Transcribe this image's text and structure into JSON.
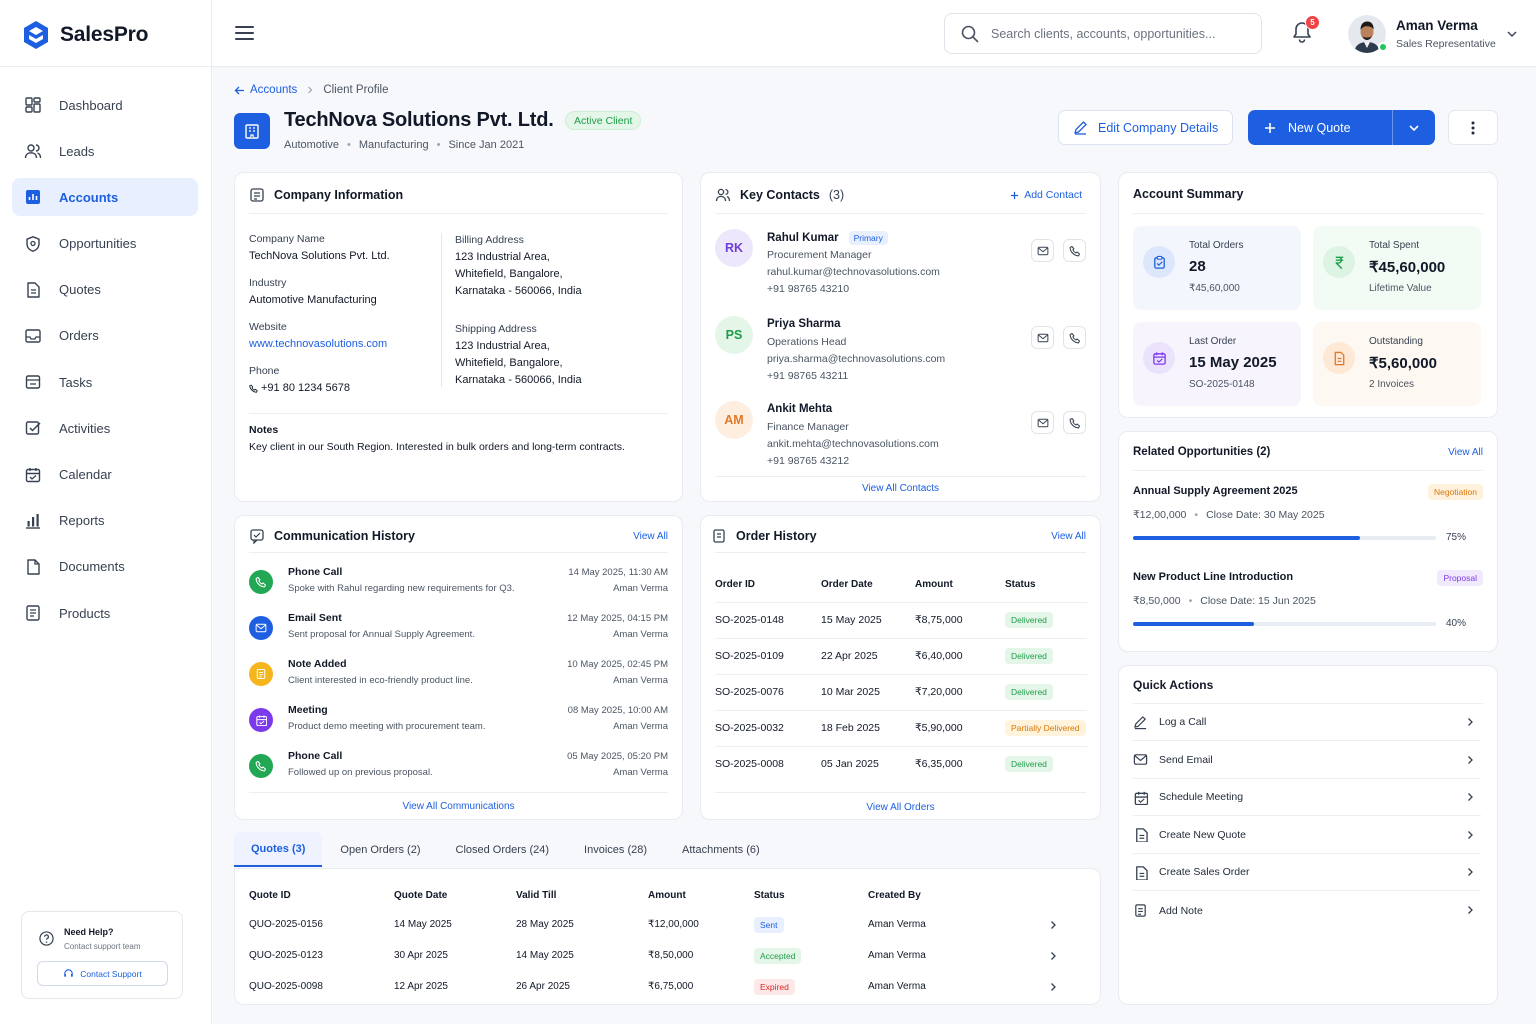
{
  "app": {
    "name": "SalesPro"
  },
  "sidebar": {
    "items": [
      {
        "label": "Dashboard",
        "icon": "dashboard-icon",
        "active": false
      },
      {
        "label": "Leads",
        "icon": "users-icon",
        "active": false
      },
      {
        "label": "Accounts",
        "icon": "building-icon",
        "active": true
      },
      {
        "label": "Opportunities",
        "icon": "shield-icon",
        "active": false
      },
      {
        "label": "Quotes",
        "icon": "document-icon",
        "active": false
      },
      {
        "label": "Orders",
        "icon": "mail-box-icon",
        "active": false
      },
      {
        "label": "Tasks",
        "icon": "tray-icon",
        "active": false
      },
      {
        "label": "Activities",
        "icon": "check-square-icon",
        "active": false
      },
      {
        "label": "Calendar",
        "icon": "calendar-icon",
        "active": false
      },
      {
        "label": "Reports",
        "icon": "bar-chart-icon",
        "active": false
      },
      {
        "label": "Documents",
        "icon": "file-icon",
        "active": false
      },
      {
        "label": "Products",
        "icon": "list-file-icon",
        "active": false
      }
    ],
    "help": {
      "title": "Need Help?",
      "subtitle": "Contact support team",
      "button": "Contact Support"
    }
  },
  "topbar": {
    "search_placeholder": "Search clients, accounts, opportunities...",
    "notifications": "5",
    "user": {
      "name": "Aman Verma",
      "role": "Sales Representative"
    }
  },
  "breadcrumb": {
    "parent": "Accounts",
    "current": "Client Profile"
  },
  "company": {
    "name": "TechNova Solutions Pvt. Ltd.",
    "status": "Active Client",
    "meta": [
      "Automotive",
      "Manufacturing",
      "Since Jan 2021"
    ]
  },
  "actions": {
    "edit": "Edit Company Details",
    "new_quote": "New Quote"
  },
  "company_info": {
    "title": "Company Information",
    "company_name_label": "Company Name",
    "company_name": "TechNova Solutions Pvt. Ltd.",
    "industry_label": "Industry",
    "industry": "Automotive Manufacturing",
    "website_label": "Website",
    "website": "www.technovasolutions.com",
    "phone_label": "Phone",
    "phone": "+91 80 1234 5678",
    "billing_label": "Billing Address",
    "billing": [
      "123 Industrial Area,",
      "Whitefield, Bangalore,",
      "Karnataka - 560066, India"
    ],
    "shipping_label": "Shipping Address",
    "shipping": [
      "123 Industrial Area,",
      "Whitefield, Bangalore,",
      "Karnataka - 560066, India"
    ],
    "notes_label": "Notes",
    "notes": "Key client in our South Region. Interested in bulk orders and long-term contracts."
  },
  "contacts": {
    "title": "Key Contacts",
    "count": "(3)",
    "add": "Add Contact",
    "view_all": "View All Contacts",
    "items": [
      {
        "initials": "RK",
        "name": "Rahul Kumar",
        "badge": "Primary",
        "role": "Procurement Manager",
        "email": "rahul.kumar@technovasolutions.com",
        "phone": "+91 98765 43210",
        "bg": "#ede7fb",
        "fg": "#6d3fd6"
      },
      {
        "initials": "PS",
        "name": "Priya Sharma",
        "badge": "",
        "role": "Operations Head",
        "email": "priya.sharma@technovasolutions.com",
        "phone": "+91 98765 43211",
        "bg": "#e4f6e8",
        "fg": "#1f9d4a"
      },
      {
        "initials": "AM",
        "name": "Ankit Mehta",
        "badge": "",
        "role": "Finance Manager",
        "email": "ankit.mehta@technovasolutions.com",
        "phone": "+91 98765 43212",
        "bg": "#fdeee0",
        "fg": "#e07a2a"
      }
    ]
  },
  "summary": {
    "title": "Account Summary",
    "stats": [
      {
        "title": "Total Orders",
        "value": "28",
        "sub": "₹45,60,000",
        "icon": "clipboard-icon",
        "bg": "#f3f6fd",
        "ic_bg": "#dde7fb",
        "ic_fg": "#1d5fe0"
      },
      {
        "title": "Total Spent",
        "value": "₹45,60,000",
        "sub": "Lifetime Value",
        "icon": "rupee-icon",
        "bg": "#f3fbf5",
        "ic_bg": "#ddf3e3",
        "ic_fg": "#1f9d4a"
      },
      {
        "title": "Last Order",
        "value": "15 May 2025",
        "sub": "SO-2025-0148",
        "icon": "calendar-check-icon",
        "bg": "#f7f4fd",
        "ic_bg": "#ebe3fb",
        "ic_fg": "#7c3aed"
      },
      {
        "title": "Outstanding",
        "value": "₹5,60,000",
        "sub": "2 Invoices",
        "icon": "invoice-icon",
        "bg": "#fdf8f2",
        "ic_bg": "#fde9d5",
        "ic_fg": "#e07a2a"
      }
    ]
  },
  "opportunities": {
    "title": "Related Opportunities (2)",
    "view_all": "View All",
    "items": [
      {
        "name": "Annual Supply Agreement 2025",
        "stage": "Negotiation",
        "amount": "₹12,00,000",
        "close": "Close Date: 30 May 2025",
        "progress": 75,
        "progress_label": "75%",
        "badge_bg": "#fff1dc",
        "badge_fg": "#d97706"
      },
      {
        "name": "New Product Line Introduction",
        "stage": "Proposal",
        "amount": "₹8,50,000",
        "close": "Close Date: 15 Jun 2025",
        "progress": 40,
        "progress_label": "40%",
        "badge_bg": "#f1e9fd",
        "badge_fg": "#7c3aed"
      }
    ]
  },
  "quick_actions": {
    "title": "Quick Actions",
    "items": [
      {
        "label": "Log a Call",
        "icon": "pencil-icon"
      },
      {
        "label": "Send Email",
        "icon": "mail-icon"
      },
      {
        "label": "Schedule Meeting",
        "icon": "calendar-icon"
      },
      {
        "label": "Create New Quote",
        "icon": "document-icon"
      },
      {
        "label": "Create Sales Order",
        "icon": "document-icon"
      },
      {
        "label": "Add Note",
        "icon": "note-icon"
      }
    ]
  },
  "communications": {
    "title": "Communication History",
    "view_all": "View All",
    "view_all_bottom": "View All Communications",
    "items": [
      {
        "type": "Phone Call",
        "desc": "Spoke with Rahul regarding new requirements for Q3.",
        "when": "14 May 2025, 11:30 AM",
        "user": "Aman Verma",
        "icon": "phone-icon",
        "color": "#22a855"
      },
      {
        "type": "Email Sent",
        "desc": "Sent proposal for Annual Supply Agreement.",
        "when": "12 May 2025, 04:15 PM",
        "user": "Aman Verma",
        "icon": "mail-icon",
        "color": "#1d5fe0"
      },
      {
        "type": "Note Added",
        "desc": "Client interested in eco-friendly product line.",
        "when": "10 May 2025, 02:45 PM",
        "user": "Aman Verma",
        "icon": "note-icon",
        "color": "#f5b51d"
      },
      {
        "type": "Meeting",
        "desc": "Product demo meeting with procurement team.",
        "when": "08 May 2025, 10:00 AM",
        "user": "Aman Verma",
        "icon": "calendar-icon",
        "color": "#7c3aed"
      },
      {
        "type": "Phone Call",
        "desc": "Followed up on previous proposal.",
        "when": "05 May 2025, 05:20 PM",
        "user": "Aman Verma",
        "icon": "phone-icon",
        "color": "#22a855"
      }
    ]
  },
  "orders": {
    "title": "Order History",
    "view_all": "View All",
    "view_all_bottom": "View All Orders",
    "columns": [
      "Order ID",
      "Order Date",
      "Amount",
      "Status"
    ],
    "rows": [
      {
        "id": "SO-2025-0148",
        "date": "15 May 2025",
        "amount": "₹8,75,000",
        "status": "Delivered",
        "kind": "delivered"
      },
      {
        "id": "SO-2025-0109",
        "date": "22 Apr 2025",
        "amount": "₹6,40,000",
        "status": "Delivered",
        "kind": "delivered"
      },
      {
        "id": "SO-2025-0076",
        "date": "10 Mar 2025",
        "amount": "₹7,20,000",
        "status": "Delivered",
        "kind": "delivered"
      },
      {
        "id": "SO-2025-0032",
        "date": "18 Feb 2025",
        "amount": "₹5,90,000",
        "status": "Partially Delivered",
        "kind": "partial"
      },
      {
        "id": "SO-2025-0008",
        "date": "05 Jan 2025",
        "amount": "₹6,35,000",
        "status": "Delivered",
        "kind": "delivered"
      }
    ]
  },
  "tabs": [
    {
      "label": "Quotes (3)",
      "active": true
    },
    {
      "label": "Open Orders (2)",
      "active": false
    },
    {
      "label": "Closed Orders (24)",
      "active": false
    },
    {
      "label": "Invoices (28)",
      "active": false
    },
    {
      "label": "Attachments (6)",
      "active": false
    }
  ],
  "quotes": {
    "columns": [
      "Quote ID",
      "Quote Date",
      "Valid Till",
      "Amount",
      "Status",
      "Created By"
    ],
    "rows": [
      {
        "id": "QUO-2025-0156",
        "date": "14 May 2025",
        "valid": "28 May 2025",
        "amount": "₹12,00,000",
        "status": "Sent",
        "kind": "sent",
        "by": "Aman Verma"
      },
      {
        "id": "QUO-2025-0123",
        "date": "30 Apr 2025",
        "valid": "14 May 2025",
        "amount": "₹8,50,000",
        "status": "Accepted",
        "kind": "accepted",
        "by": "Aman Verma"
      },
      {
        "id": "QUO-2025-0098",
        "date": "12 Apr 2025",
        "valid": "26 Apr 2025",
        "amount": "₹6,75,000",
        "status": "Expired",
        "kind": "expired",
        "by": "Aman Verma"
      }
    ]
  }
}
